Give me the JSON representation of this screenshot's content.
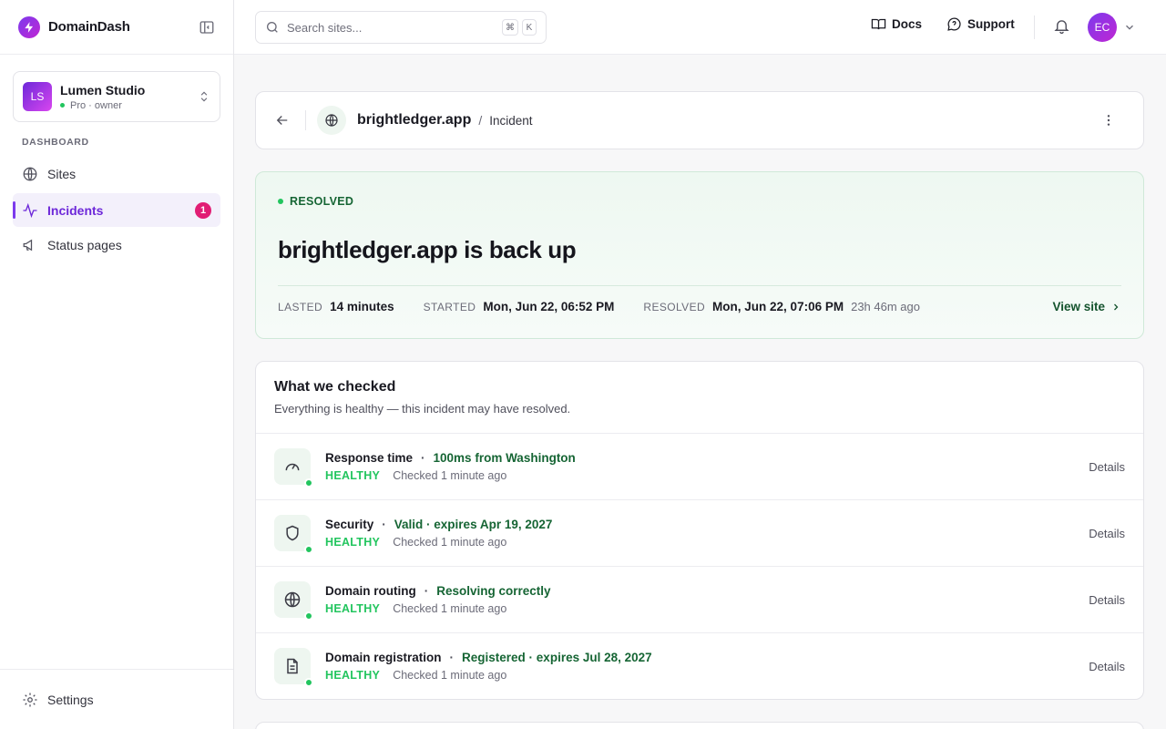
{
  "brand": {
    "name": "DomainDash"
  },
  "workspace": {
    "initials": "LS",
    "name": "Lumen Studio",
    "plan": "Pro · owner"
  },
  "nav": {
    "section": "DASHBOARD",
    "items": [
      {
        "label": "Sites"
      },
      {
        "label": "Incidents",
        "badge": "1"
      },
      {
        "label": "Status pages"
      }
    ],
    "settings": "Settings"
  },
  "search": {
    "placeholder": "Search sites...",
    "kbd": [
      "⌘",
      "K"
    ]
  },
  "topbar": {
    "docs": "Docs",
    "support": "Support",
    "user_initials": "EC"
  },
  "header": {
    "site": "brightledger.app",
    "separator": "/",
    "crumb": "Incident"
  },
  "status": {
    "badge": "RESOLVED",
    "title": "brightledger.app is back up",
    "lasted_label": "LASTED",
    "lasted_value": "14 minutes",
    "started_label": "STARTED",
    "started_value": "Mon, Jun 22, 06:52 PM",
    "resolved_label": "RESOLVED",
    "resolved_value": "Mon, Jun 22, 07:06 PM",
    "resolved_ago": "23h 46m ago",
    "view_site": "View site"
  },
  "checks": {
    "title": "What we checked",
    "subtitle": "Everything is healthy — this incident may have resolved.",
    "items": [
      {
        "name": "Response time",
        "detail": "100ms from Washington",
        "status": "HEALTHY",
        "checked": "Checked 1 minute ago",
        "action": "Details",
        "icon": "gauge-icon"
      },
      {
        "name": "Security",
        "detail": "Valid · expires Apr 19, 2027",
        "status": "HEALTHY",
        "checked": "Checked 1 minute ago",
        "action": "Details",
        "icon": "shield-icon"
      },
      {
        "name": "Domain routing",
        "detail": "Resolving correctly",
        "status": "HEALTHY",
        "checked": "Checked 1 minute ago",
        "action": "Details",
        "icon": "globe-icon"
      },
      {
        "name": "Domain registration",
        "detail": "Registered · expires Jul 28, 2027",
        "status": "HEALTHY",
        "checked": "Checked 1 minute ago",
        "action": "Details",
        "icon": "document-icon"
      }
    ]
  },
  "colors": {
    "accent": "#7c3aed",
    "healthy": "#22c55e",
    "badge": "#e11d74"
  }
}
